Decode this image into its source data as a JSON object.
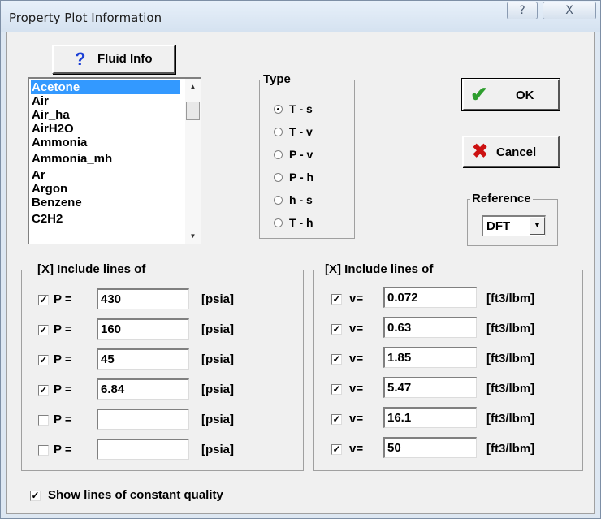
{
  "window": {
    "title": "Property Plot Information",
    "help_glyph": "?",
    "close_glyph": "X"
  },
  "fluid_info": {
    "label": "Fluid Info",
    "icon": "?"
  },
  "fluids": [
    "Acetone",
    "Air",
    "Air_ha",
    "AirH2O",
    "Ammonia",
    "Ammonia_mh",
    "Ar",
    "Argon",
    "Benzene",
    "C2H2"
  ],
  "type_group": {
    "label": "Type",
    "options": [
      "T - s",
      "T - v",
      "P - v",
      "P - h",
      "h - s",
      "T - h"
    ],
    "selected": 0
  },
  "ok_button": {
    "label": "OK"
  },
  "cancel_button": {
    "label": "Cancel"
  },
  "reference": {
    "label": "Reference",
    "value": "DFT"
  },
  "pressure_group": {
    "label": "[X] Include lines of",
    "prefix": "P =",
    "unit": "[psia]",
    "rows": [
      {
        "checked": true,
        "value": "430"
      },
      {
        "checked": true,
        "value": "160"
      },
      {
        "checked": true,
        "value": "45"
      },
      {
        "checked": true,
        "value": "6.84"
      },
      {
        "checked": false,
        "value": ""
      },
      {
        "checked": false,
        "value": ""
      }
    ]
  },
  "volume_group": {
    "label": "[X] Include lines of",
    "prefix": "v=",
    "unit": "[ft3/lbm]",
    "rows": [
      {
        "checked": true,
        "value": "0.072"
      },
      {
        "checked": true,
        "value": "0.63"
      },
      {
        "checked": true,
        "value": "1.85"
      },
      {
        "checked": true,
        "value": "5.47"
      },
      {
        "checked": true,
        "value": "16.1"
      },
      {
        "checked": true,
        "value": "50"
      }
    ]
  },
  "quality": {
    "checked": true,
    "label": "Show lines of constant quality"
  },
  "colors": {
    "selection": "#3399ff",
    "ok_check": "#2e9e2e",
    "cancel_x": "#cc1111",
    "help_icon": "#1a3fd6"
  }
}
